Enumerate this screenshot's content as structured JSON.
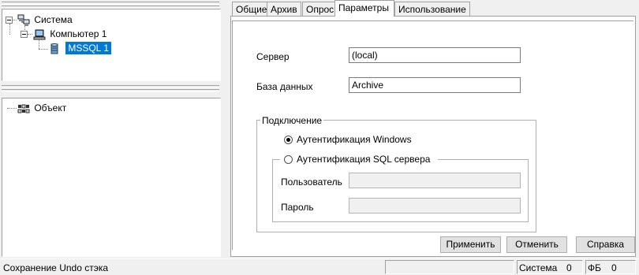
{
  "tree_top": {
    "items": [
      {
        "label": "Система",
        "icon": "network-computers-icon"
      },
      {
        "label": "Компьютер 1",
        "icon": "computer-icon"
      },
      {
        "label": "MSSQL 1",
        "icon": "database-icon",
        "selected": true
      }
    ]
  },
  "tree_bottom": {
    "items": [
      {
        "label": "Объект",
        "icon": "object-grid-icon"
      }
    ]
  },
  "tabs": [
    {
      "label": "Общие"
    },
    {
      "label": "Архив"
    },
    {
      "label": "Опрос"
    },
    {
      "label": "Параметры",
      "active": true
    },
    {
      "label": "Использование"
    }
  ],
  "form": {
    "server_label": "Сервер",
    "server_value": "(local)",
    "database_label": "База данных",
    "database_value": "Archive",
    "connection_group": "Подключение",
    "windows_auth_label": "Аутентификация Windows",
    "windows_auth_checked": true,
    "sql_auth_label": "Аутентификация SQL сервера",
    "sql_auth_checked": false,
    "user_label": "Пользователь",
    "user_value": "",
    "password_label": "Пароль",
    "password_value": ""
  },
  "buttons": {
    "apply": "Применить",
    "cancel": "Отменить",
    "help": "Справка"
  },
  "status": {
    "message": "Сохранение Undo стэка",
    "system_label": "Система",
    "system_value": "0",
    "fb_label": "ФБ",
    "fb_value": "0"
  },
  "colors": {
    "selection": "#0078d7",
    "window_bg": "#f0f0f0",
    "panel_bg": "#ffffff"
  }
}
